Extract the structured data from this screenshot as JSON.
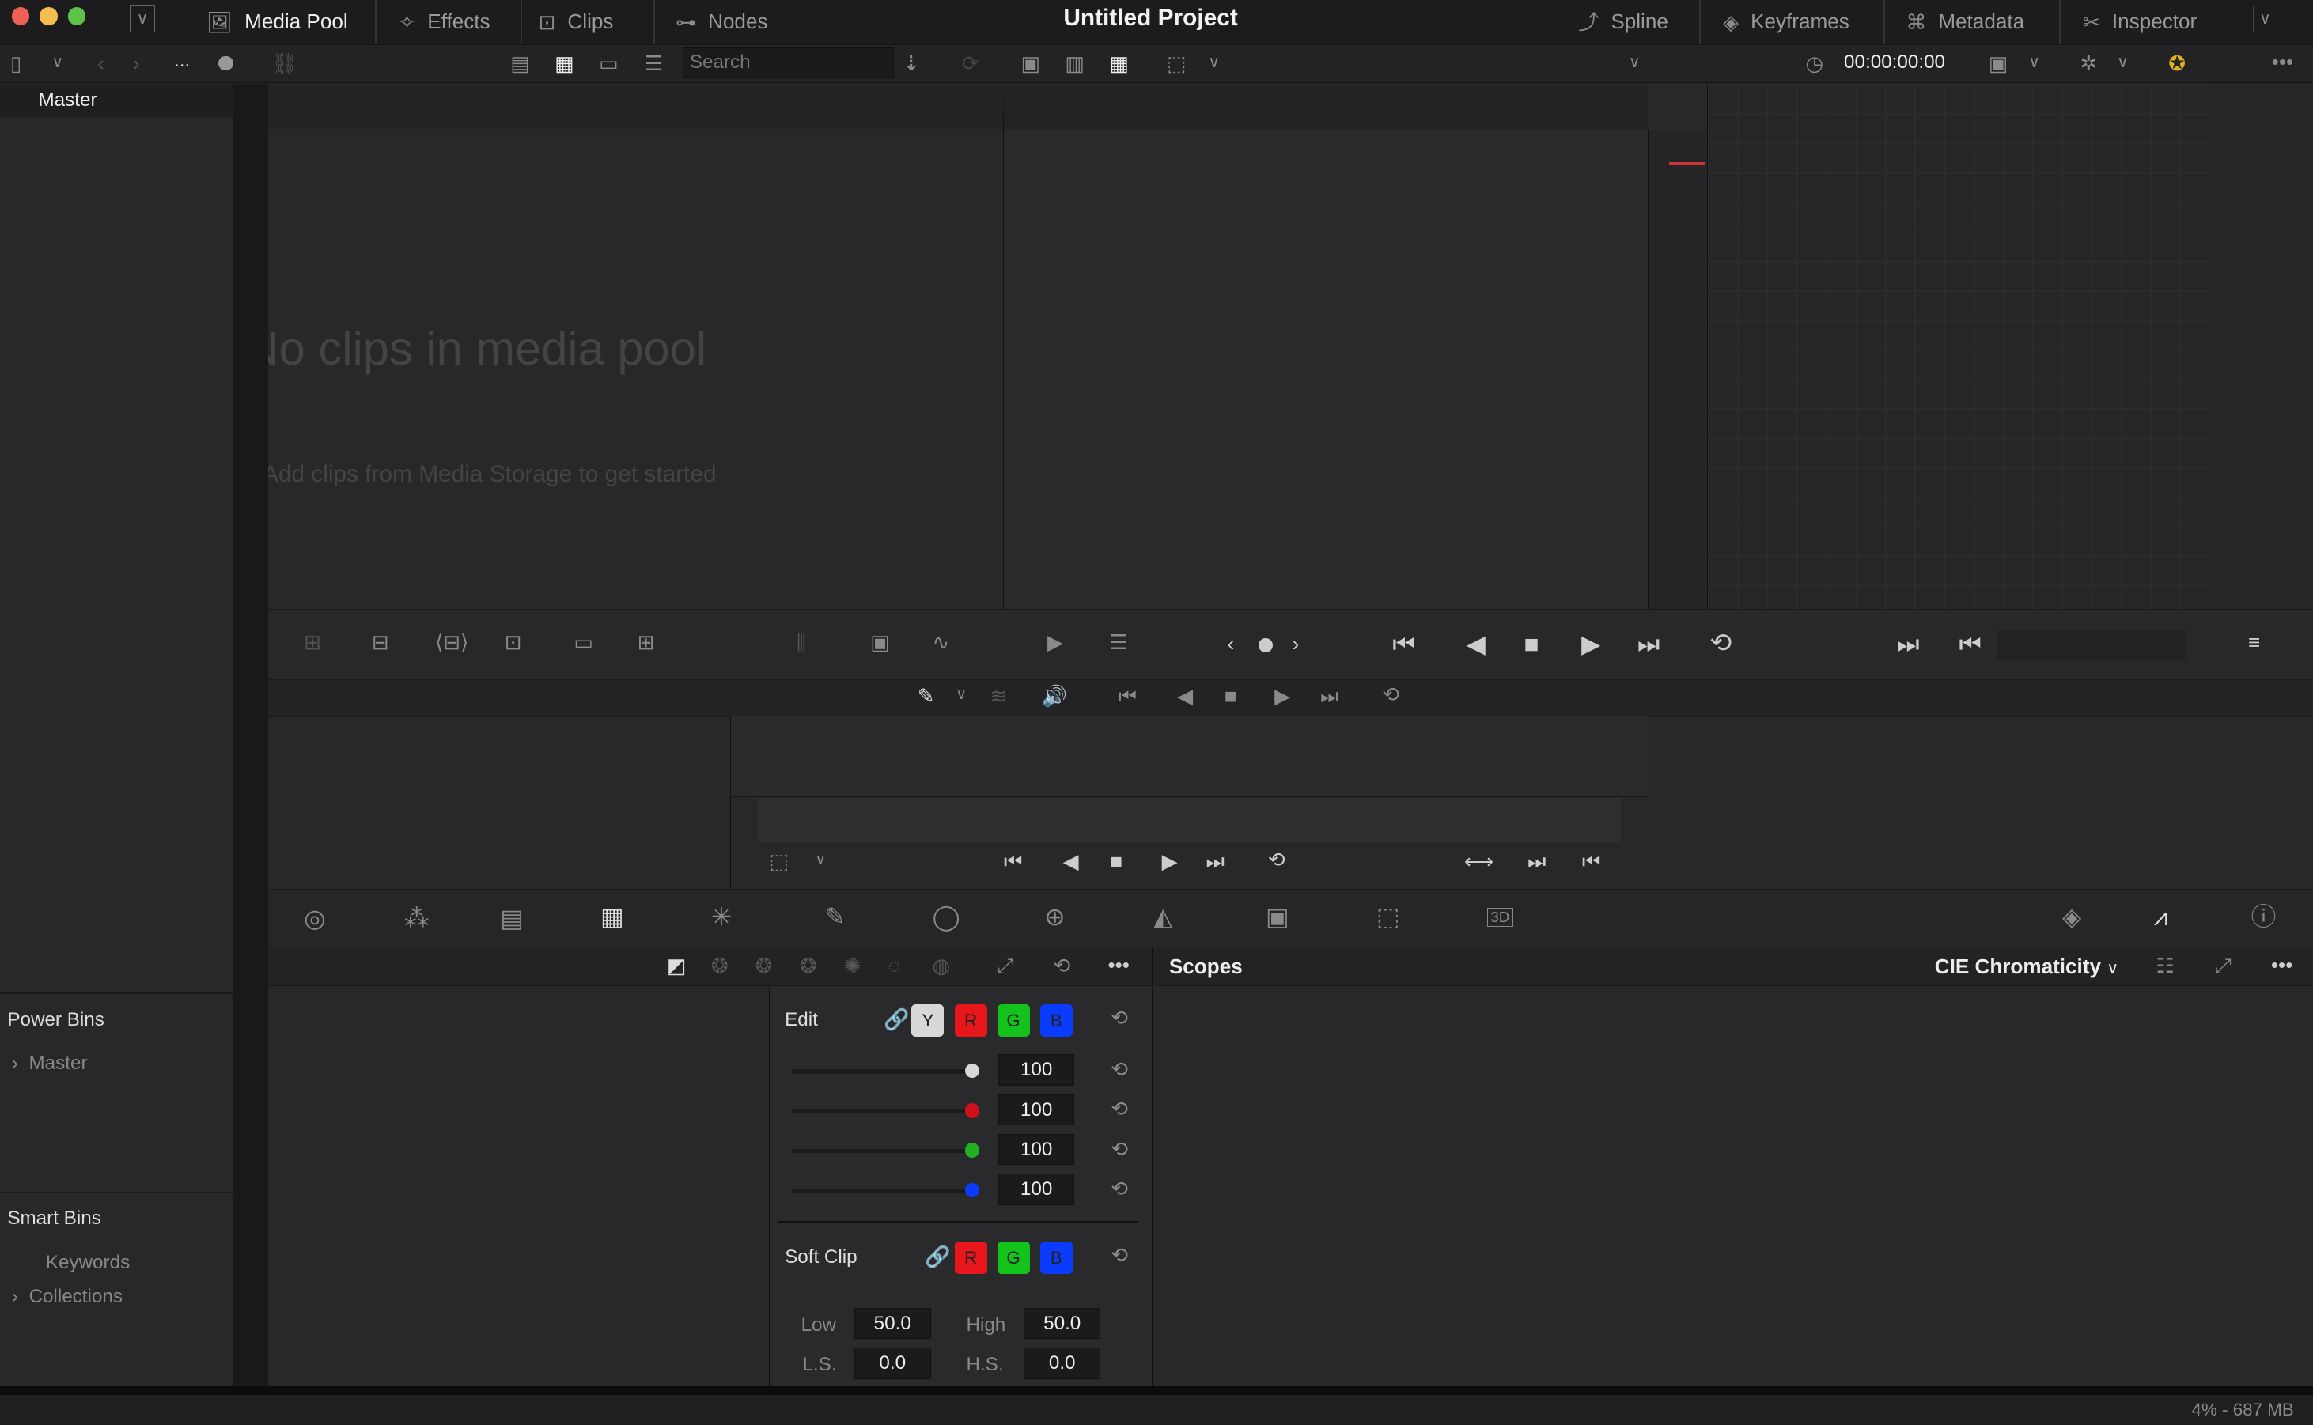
{
  "window": {
    "title": "Untitled Project",
    "traffic_lights": [
      "#ee5f57",
      "#f5bd4f",
      "#5ec448"
    ]
  },
  "top_tabs_left": [
    {
      "label": "Media Pool",
      "icon": "media-pool-icon",
      "active": true
    },
    {
      "label": "Effects",
      "icon": "effects-icon"
    },
    {
      "label": "Clips",
      "icon": "clips-icon"
    },
    {
      "label": "Nodes",
      "icon": "nodes-icon"
    }
  ],
  "top_tabs_right": [
    {
      "label": "Spline",
      "icon": "spline-icon"
    },
    {
      "label": "Keyframes",
      "icon": "keyframes-icon"
    },
    {
      "label": "Metadata",
      "icon": "metadata-icon"
    },
    {
      "label": "Inspector",
      "icon": "inspector-icon"
    }
  ],
  "toolbar": {
    "search_placeholder": "Search",
    "timecode": "00:00:00:00",
    "more": "..."
  },
  "sidebar": {
    "master": "Master",
    "power_bins": {
      "title": "Power Bins",
      "items": [
        "Master"
      ]
    },
    "smart_bins": {
      "title": "Smart Bins",
      "items": [
        "Keywords",
        "Collections"
      ]
    }
  },
  "media_pool": {
    "empty_title": "No clips in media pool",
    "empty_subtitle": "Add clips from Media Storage to get started"
  },
  "scopes": {
    "title": "Scopes",
    "mode": "CIE Chromaticity"
  },
  "edit_panel": {
    "edit_label": "Edit",
    "channels": [
      "Y",
      "R",
      "G",
      "B"
    ],
    "channel_colors": {
      "Y": "#d8d8d8",
      "R": "#e8171b",
      "G": "#13c31b",
      "B": "#0a3cff"
    },
    "sliders": [
      {
        "channel": "Y",
        "value": "100"
      },
      {
        "channel": "R",
        "value": "100"
      },
      {
        "channel": "G",
        "value": "100"
      },
      {
        "channel": "B",
        "value": "100"
      }
    ],
    "soft_clip_label": "Soft Clip",
    "soft_channels": [
      "R",
      "G",
      "B"
    ],
    "low_label": "Low",
    "low": "50.0",
    "high_label": "High",
    "high": "50.0",
    "ls_label": "L.S.",
    "ls": "0.0",
    "hs_label": "H.S.",
    "hs": "0.0"
  },
  "status": {
    "memory": "4% - 687 MB"
  }
}
